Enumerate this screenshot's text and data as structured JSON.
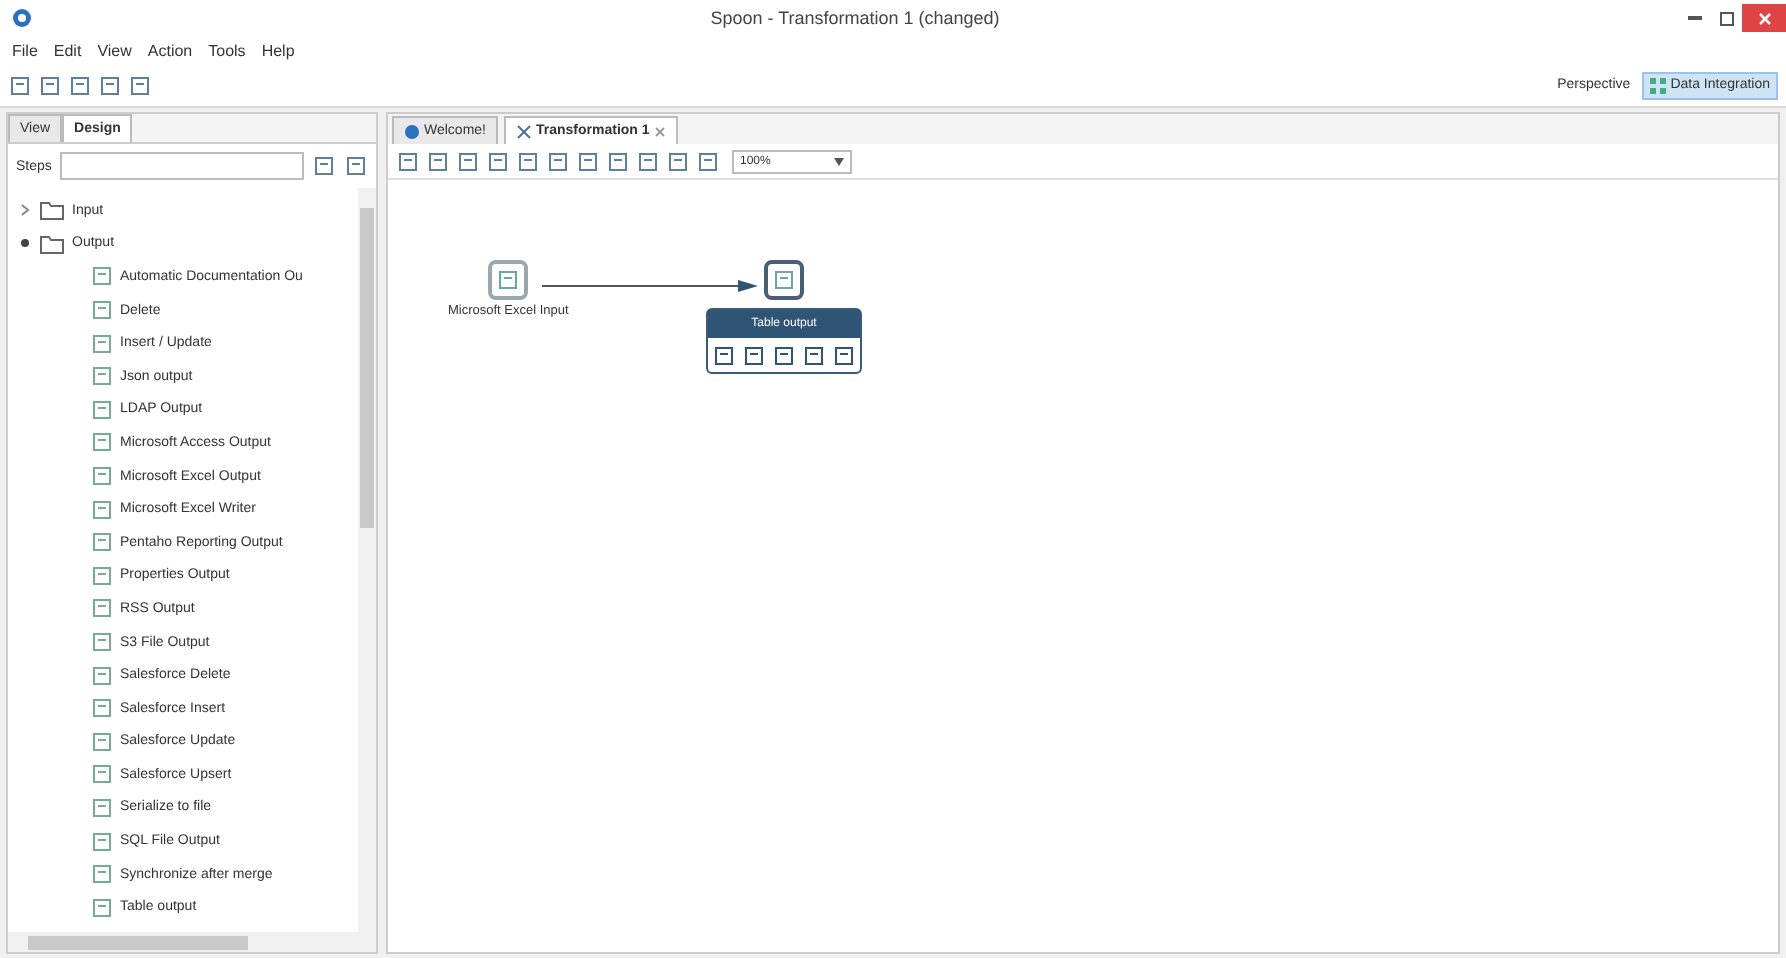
{
  "window": {
    "title": "Spoon - Transformation 1 (changed)"
  },
  "menu": [
    "File",
    "Edit",
    "View",
    "Action",
    "Tools",
    "Help"
  ],
  "perspective": {
    "label": "Perspective",
    "value": "Data Integration"
  },
  "left_tabs": [
    {
      "label": "View",
      "selected": false
    },
    {
      "label": "Design",
      "selected": true
    }
  ],
  "steps_search": {
    "label": "Steps"
  },
  "tree": [
    {
      "label": "Input",
      "expanded": false
    },
    {
      "label": "Output",
      "expanded": true,
      "children": [
        {
          "label": "Automatic Documentation Ou"
        },
        {
          "label": "Delete"
        },
        {
          "label": "Insert / Update"
        },
        {
          "label": "Json output"
        },
        {
          "label": "LDAP Output"
        },
        {
          "label": "Microsoft Access Output"
        },
        {
          "label": "Microsoft Excel Output"
        },
        {
          "label": "Microsoft Excel Writer"
        },
        {
          "label": "Pentaho Reporting Output"
        },
        {
          "label": "Properties Output"
        },
        {
          "label": "RSS Output"
        },
        {
          "label": "S3 File Output"
        },
        {
          "label": "Salesforce Delete"
        },
        {
          "label": "Salesforce Insert"
        },
        {
          "label": "Salesforce Update"
        },
        {
          "label": "Salesforce Upsert"
        },
        {
          "label": "Serialize to file"
        },
        {
          "label": "SQL File Output"
        },
        {
          "label": "Synchronize after merge"
        },
        {
          "label": "Table output"
        }
      ]
    }
  ],
  "editor_tabs": [
    {
      "label": "Welcome!",
      "selected": false,
      "closable": false
    },
    {
      "label": "Transformation 1",
      "selected": true,
      "closable": true
    }
  ],
  "zoom": "100%",
  "canvas": {
    "nodes": [
      {
        "label": "Microsoft Excel Input",
        "hovered": false
      },
      {
        "label": "Table output",
        "hovered": true
      }
    ]
  }
}
